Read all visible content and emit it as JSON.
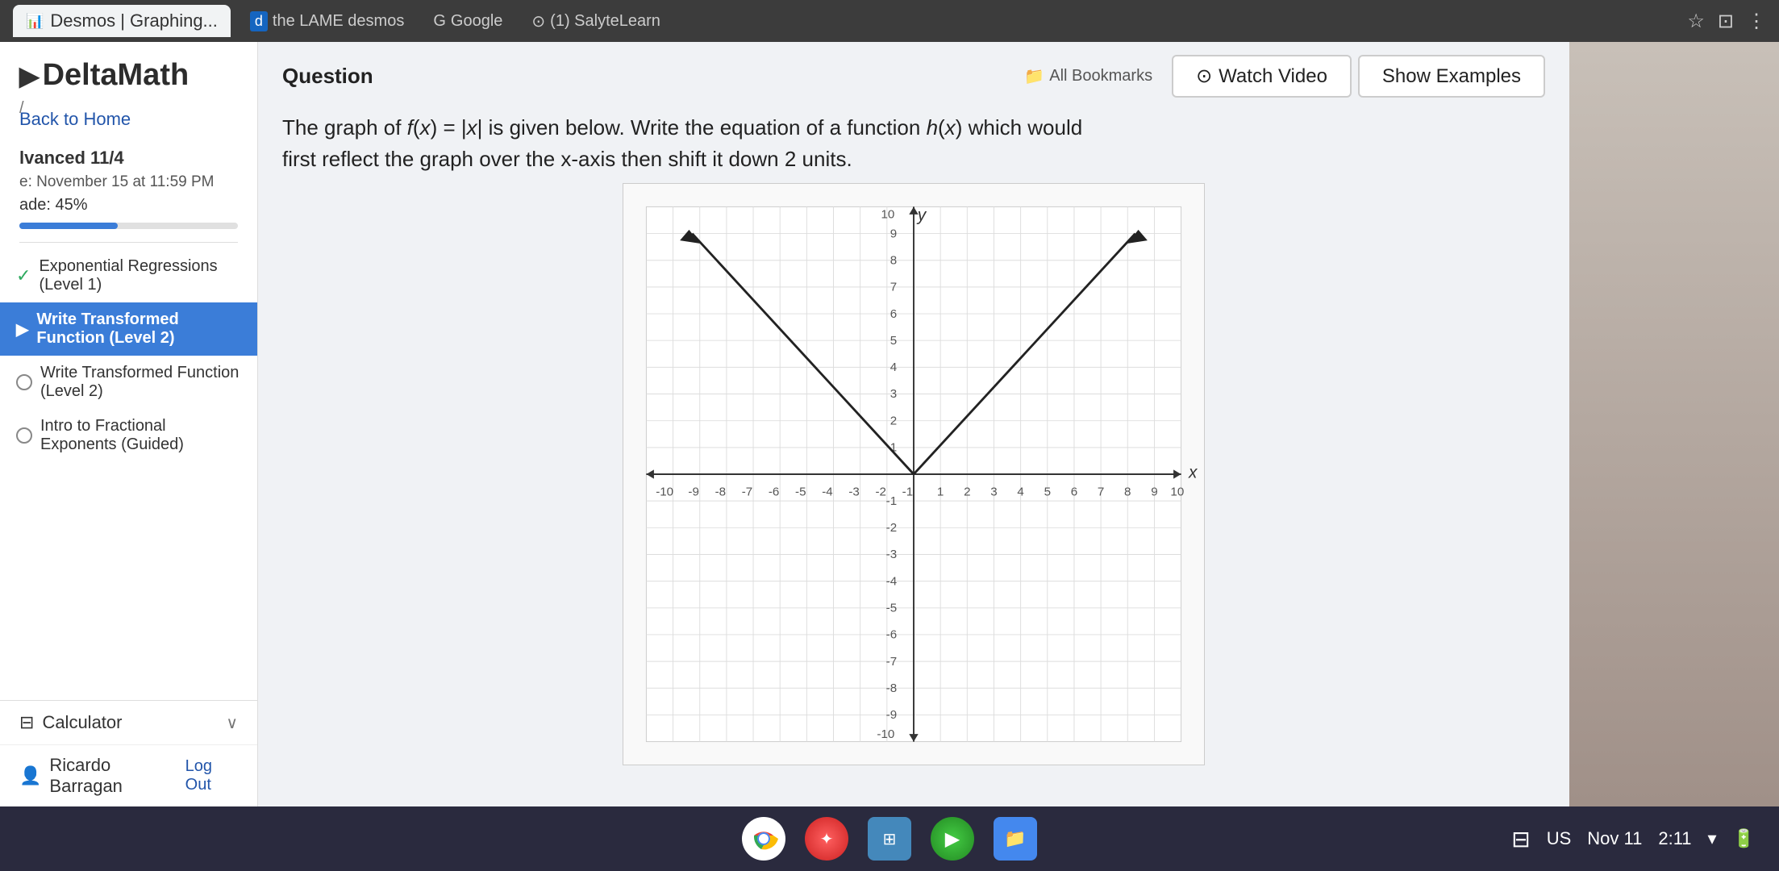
{
  "browser": {
    "tabs": [
      {
        "label": "Desmos | Graphing...",
        "icon": "📈",
        "active": true
      },
      {
        "label": "the LAME desmos",
        "icon": "d",
        "active": false
      },
      {
        "label": "Google",
        "icon": "G",
        "active": false
      },
      {
        "label": "(1) SalyteLearn",
        "icon": "⊙",
        "active": false
      }
    ],
    "bookmarks": "All Bookmarks"
  },
  "sidebar": {
    "logo": "DeltaMath",
    "back_to_home": "Back to Home",
    "assignment_title": "lvanced 11/4",
    "due_label": "e: November 15 at 11:59 PM",
    "grade_label": "ade: 45%",
    "progress_percent": 45,
    "items": [
      {
        "label": "Exponential Regressions (Level 1)",
        "status": "check",
        "active": false
      },
      {
        "label": "Write Transformed Function (Level 2)",
        "status": "arrow",
        "active": true
      },
      {
        "label": "Write Transformed Function (Level 2)",
        "status": "dot",
        "active": false
      },
      {
        "label": "Intro to Fractional Exponents (Guided)",
        "status": "dot",
        "active": false
      },
      {
        "label": "...",
        "status": "dot",
        "active": false
      }
    ],
    "calculator_label": "Calculator",
    "user_name": "Ricardo Barragan",
    "logout_label": "Log Out"
  },
  "question": {
    "section_label": "Question",
    "watch_video_label": "Watch Video",
    "show_examples_label": "Show Examples",
    "bookmarks_label": "All Bookmarks",
    "text_line1": "The graph of f(x) = |x| is given below. Write the equation of a function h(x) which would",
    "text_line2": "first reflect the graph over the x-axis then shift it down 2 units."
  },
  "graph": {
    "x_min": -10,
    "x_max": 10,
    "y_min": -10,
    "y_max": 10
  },
  "taskbar": {
    "time": "2:11",
    "date": "Nov 11",
    "locale": "US"
  }
}
